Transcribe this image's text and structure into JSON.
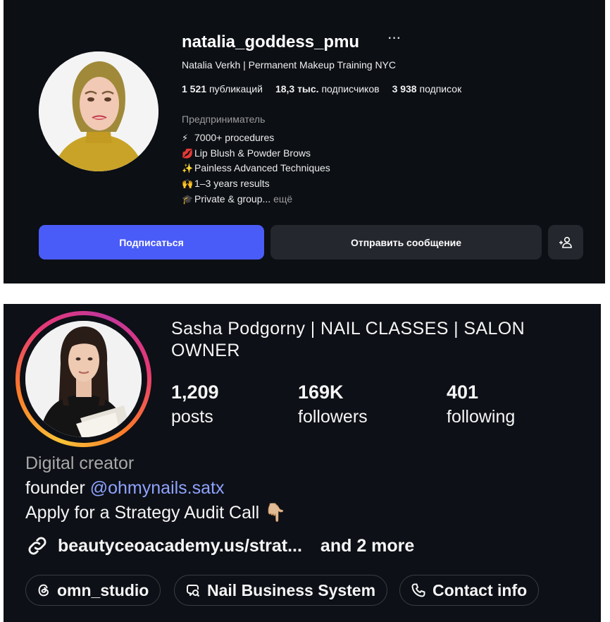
{
  "profile_top": {
    "username": "natalia_goddess_pmu",
    "more_glyph": "···",
    "full_name": "Natalia Verkh | Permanent Makeup Training NYC",
    "stats": [
      {
        "value": "1 521",
        "label": "публикаций"
      },
      {
        "value": "18,3 тыс.",
        "label": "подписчиков"
      },
      {
        "value": "3 938",
        "label": "подписок"
      }
    ],
    "category": "Предприниматель",
    "bio_lines": [
      {
        "emoji": "⚡",
        "text": "7000+ procedures"
      },
      {
        "emoji": "💋",
        "text": "Lip Blush & Powder Brows"
      },
      {
        "emoji": "✨",
        "text": "Painless Advanced Techniques"
      },
      {
        "emoji": "🙌",
        "text": "1–3 years results"
      },
      {
        "emoji": "🎓",
        "text": "Private & group..."
      }
    ],
    "bio_more": "ещё",
    "follow_label": "Подписаться",
    "message_label": "Отправить сообщение",
    "colors": {
      "accent": "#4a5cf7",
      "secondary_button": "#24272d",
      "background": "#0c0f14"
    }
  },
  "profile_bottom": {
    "name": "Sasha Podgorny | NAIL CLASSES |  SALON OWNER",
    "stats": [
      {
        "value": "1,209",
        "label": "posts"
      },
      {
        "value": "169K",
        "label": "followers"
      },
      {
        "value": "401",
        "label": "following"
      }
    ],
    "category": "Digital creator",
    "bio_prefix": "founder ",
    "mention": "@ohmynails.satx",
    "bio_line2": "Apply for a Strategy Audit Call 👇🏼",
    "link_text": "beautyceoacademy.us/strat...",
    "link_more": "and 2 more",
    "chips": [
      {
        "label": "omn_studio",
        "icon": "threads-icon"
      },
      {
        "label": "Nail Business System",
        "icon": "chat-icon"
      },
      {
        "label": "Contact info",
        "icon": "phone-icon"
      }
    ],
    "colors": {
      "mention": "#8ea3ff",
      "ring_start": "#f9c237",
      "ring_end": "#c0379c"
    }
  }
}
